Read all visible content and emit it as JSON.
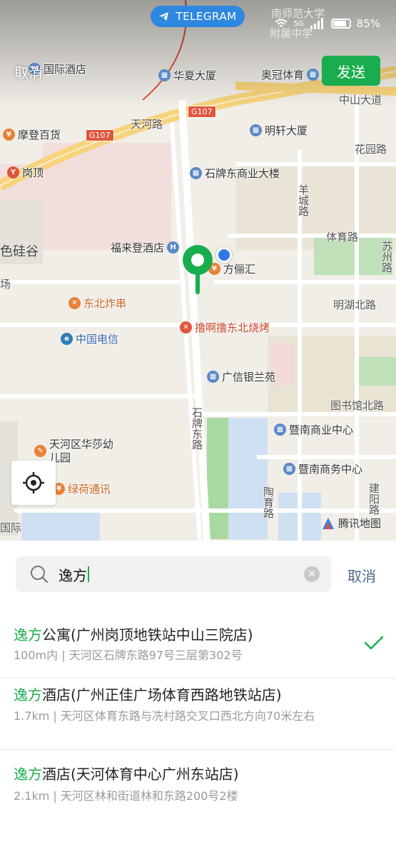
{
  "status_bar": {
    "telegram_label": "TELEGRAM",
    "signal_label": "5G",
    "battery": "85%"
  },
  "header": {
    "cancel_label": "取消",
    "send_label": "发送"
  },
  "map": {
    "pois": [
      {
        "id": "guoji",
        "label": "国际酒店",
        "icon": "hotel-icon",
        "color": "blue"
      },
      {
        "id": "huaxia",
        "label": "华夏大厦",
        "icon": "building-icon",
        "color": "blue"
      },
      {
        "id": "aoguan",
        "label": "奥冠体育",
        "icon": "building-icon",
        "color": "blue"
      },
      {
        "id": "modeng",
        "label": "摩登百货",
        "icon": "shopping-icon",
        "color": "orange"
      },
      {
        "id": "gangding",
        "label": "岗顶",
        "icon": "metro-icon",
        "color": "red"
      },
      {
        "id": "mingxuan",
        "label": "明轩大厦",
        "icon": "building-icon",
        "color": "blue"
      },
      {
        "id": "shipai",
        "label": "石牌东商业大楼",
        "icon": "building-icon",
        "color": "blue"
      },
      {
        "id": "fulaideng",
        "label": "福来登酒店",
        "icon": "hotel-icon",
        "color": "blue"
      },
      {
        "id": "fanglihui",
        "label": "方俪汇",
        "icon": "shopping-icon",
        "color": "orange"
      },
      {
        "id": "dongbei",
        "label": "东北炸串",
        "icon": "food-icon",
        "color": "orange"
      },
      {
        "id": "telecom",
        "label": "中国电信",
        "icon": "telecom-icon",
        "color": "blue"
      },
      {
        "id": "shaokao",
        "label": "撸啊撸东北烧烤",
        "icon": "food-icon",
        "color": "red"
      },
      {
        "id": "guangxin",
        "label": "广信银兰苑",
        "icon": "building-icon",
        "color": "blue"
      },
      {
        "id": "huasha",
        "label": "天河区华莎幼儿园",
        "icon": "school-icon",
        "color": "orange"
      },
      {
        "id": "lvhe",
        "label": "绿荷通讯",
        "icon": "shopping-icon",
        "color": "orange"
      },
      {
        "id": "jinan_sy",
        "label": "暨南商业中心",
        "icon": "building-icon",
        "color": "blue"
      },
      {
        "id": "jinan_sw",
        "label": "暨南商务中心",
        "icon": "building-icon",
        "color": "blue"
      }
    ],
    "roads": {
      "tianhe": "天河路",
      "zhongshan": "中山大道",
      "huayuan": "花园路",
      "yangcheng": "羊城路",
      "tiyu": "体育路",
      "suzhou": "苏州路",
      "minghu": "明湖北路",
      "shipaidong": "石牌东路",
      "tushuguan": "图书馆北路",
      "taoyu": "陶育路",
      "jianyang": "建阳路",
      "g107_a": "G107",
      "g107_b": "G107",
      "nanshi": "南师范大学",
      "fushu": "附属中学",
      "guoji2": "国际"
    },
    "district_label": "色硅谷",
    "side_label": "场",
    "attribution": "腾讯地图"
  },
  "search": {
    "query": "逸方",
    "cancel_label": "取消"
  },
  "results": [
    {
      "highlight": "逸方",
      "rest": "公寓(广州岗顶地铁站中山三院店)",
      "address": "100m内 | 天河区石牌东路97号三层第302号",
      "selected": true
    },
    {
      "highlight": "逸方",
      "rest": "酒店(广州正佳广场体育西路地铁站店)",
      "address": "1.7km | 天河区体育东路与冼村路交叉口西北方向70米左右",
      "selected": false
    },
    {
      "highlight": "逸方",
      "rest": "酒店(天河体育中心广州东站店)",
      "address": "2.1km | 天河区林和街道林和东路200号2楼",
      "selected": false
    }
  ],
  "colors": {
    "accent": "#1aad4f",
    "link": "#4a6690",
    "telegram": "#2f88e0"
  }
}
